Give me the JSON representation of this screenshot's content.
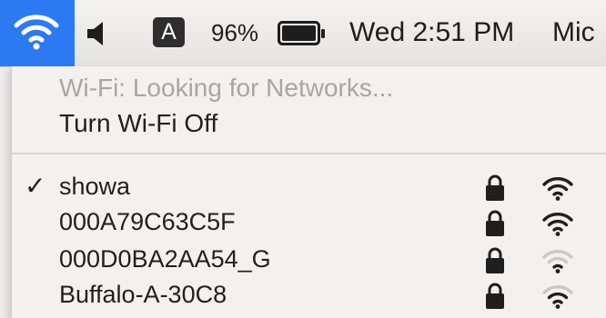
{
  "menubar": {
    "wifi_icon": "wifi-icon",
    "volume_icon": "speaker-icon",
    "input_source_label": "A",
    "battery_percent": "96%",
    "battery_icon": "battery-icon",
    "clock": "Wed 2:51 PM",
    "user_name": "Mic"
  },
  "wifi_menu": {
    "status": "Wi-Fi: Looking for Networks...",
    "toggle_label": "Turn Wi-Fi Off",
    "networks": [
      {
        "name": "showa",
        "checked": true,
        "checkmark": "✓",
        "locked": true,
        "signal": 3
      },
      {
        "name": "000A79C63C5F",
        "checked": false,
        "checkmark": "",
        "locked": true,
        "signal": 3
      },
      {
        "name": "000D0BA2AA54_G",
        "checked": false,
        "checkmark": "",
        "locked": true,
        "signal": 1
      },
      {
        "name": "Buffalo-A-30C8",
        "checked": false,
        "checkmark": "",
        "locked": true,
        "signal": 2
      }
    ]
  },
  "colors": {
    "highlight": "#2c79f2",
    "signal_active": "#1f1f1f",
    "signal_inactive": "#c8c8c8",
    "disabled_text": "#a6a6a6"
  }
}
